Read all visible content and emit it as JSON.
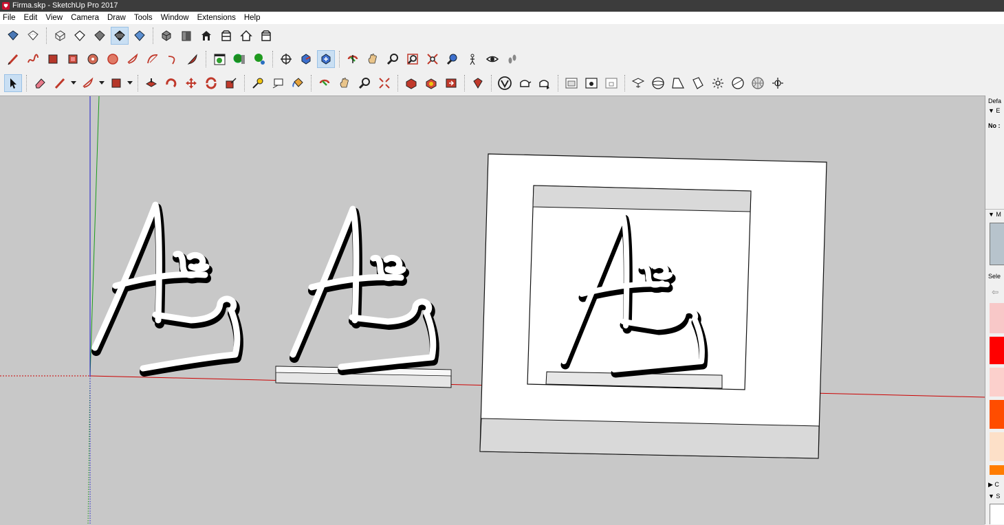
{
  "window": {
    "title": "Firma.skp - SketchUp Pro 2017"
  },
  "menu": [
    "File",
    "Edit",
    "View",
    "Camera",
    "Draw",
    "Tools",
    "Window",
    "Extensions",
    "Help"
  ],
  "tray": {
    "panel_title": "Defa",
    "entity_header": "▼ E",
    "entity_text": "No :",
    "materials_header": "▼ M",
    "select_label": "Sele",
    "components_header": "▶ C",
    "styles_header": "▼ S"
  },
  "swatches": [
    "#f8c8c8",
    "#ff0000",
    "#fcd0cc",
    "#ff4d00",
    "#fde0c8",
    "#ff7c00"
  ],
  "colors": {
    "viewport": "#c8c8c8",
    "axis_red": "#cc0000",
    "axis_green": "#1a9a1a",
    "axis_blue": "#1a1acc"
  }
}
